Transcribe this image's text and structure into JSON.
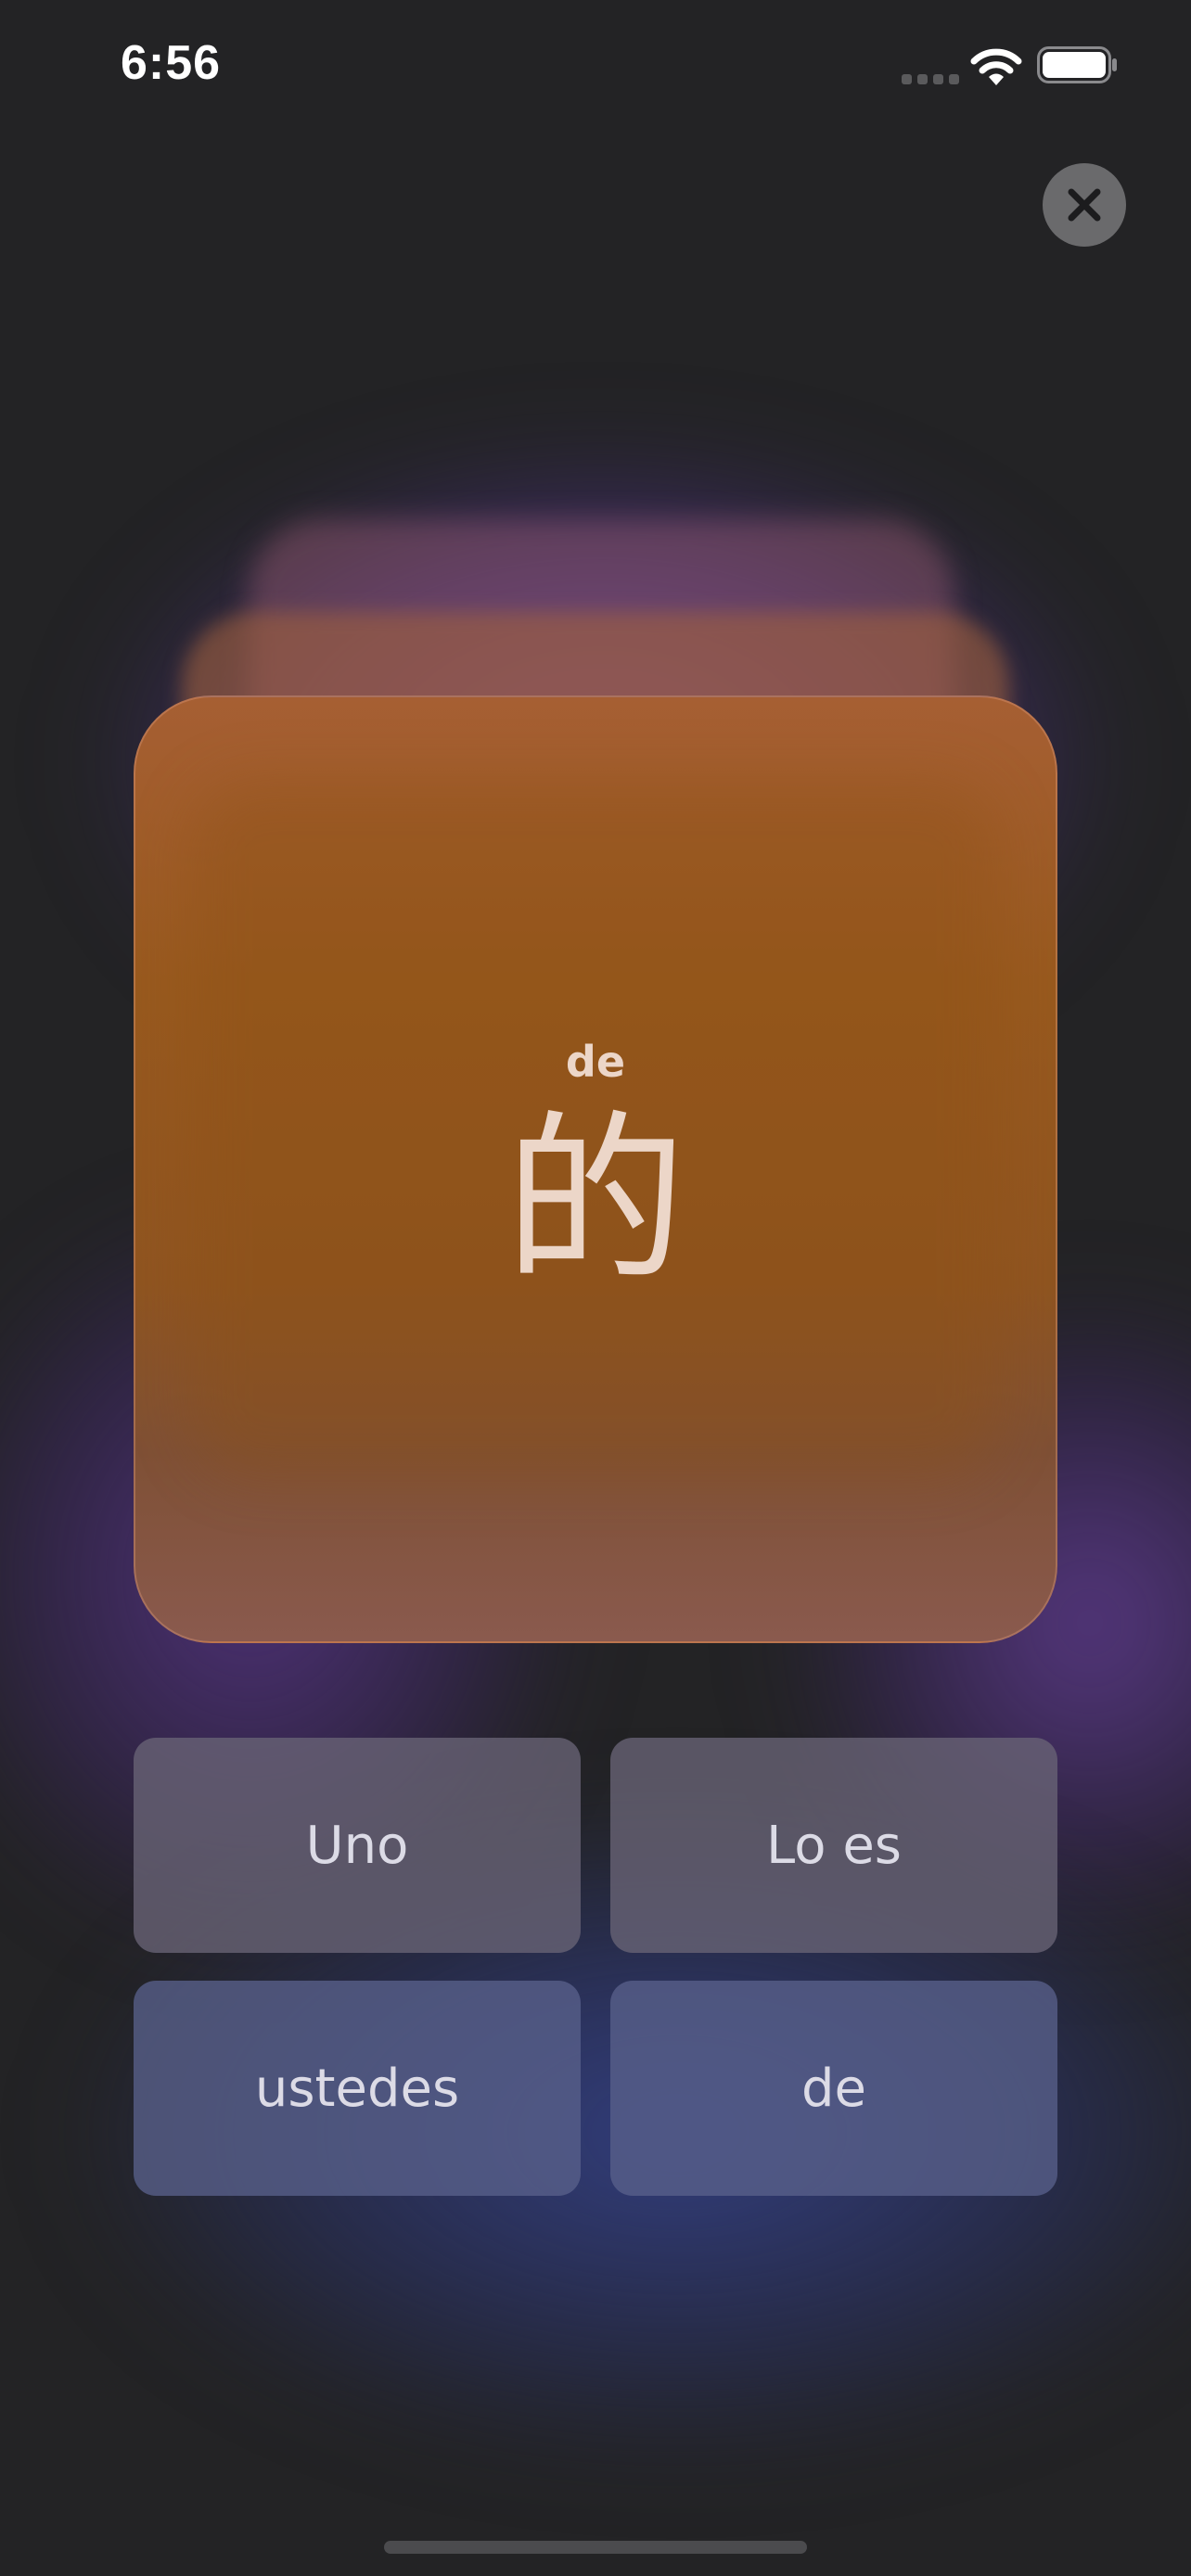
{
  "status_bar": {
    "time": "6:56",
    "signal_icon": "cellular-signal-icon",
    "wifi_icon": "wifi-icon",
    "battery_icon": "battery-full-icon"
  },
  "close_button": {
    "icon": "close-icon",
    "color": "#6a6a6c"
  },
  "flashcard": {
    "pinyin": "de",
    "character": "的",
    "color": "#98591e"
  },
  "answers": [
    {
      "label": "Uno"
    },
    {
      "label": "Lo es"
    },
    {
      "label": "ustedes"
    },
    {
      "label": "de"
    }
  ],
  "colors": {
    "background": "#232325",
    "text": "#ecd6c8",
    "answer_text": "#dcdbe6"
  }
}
